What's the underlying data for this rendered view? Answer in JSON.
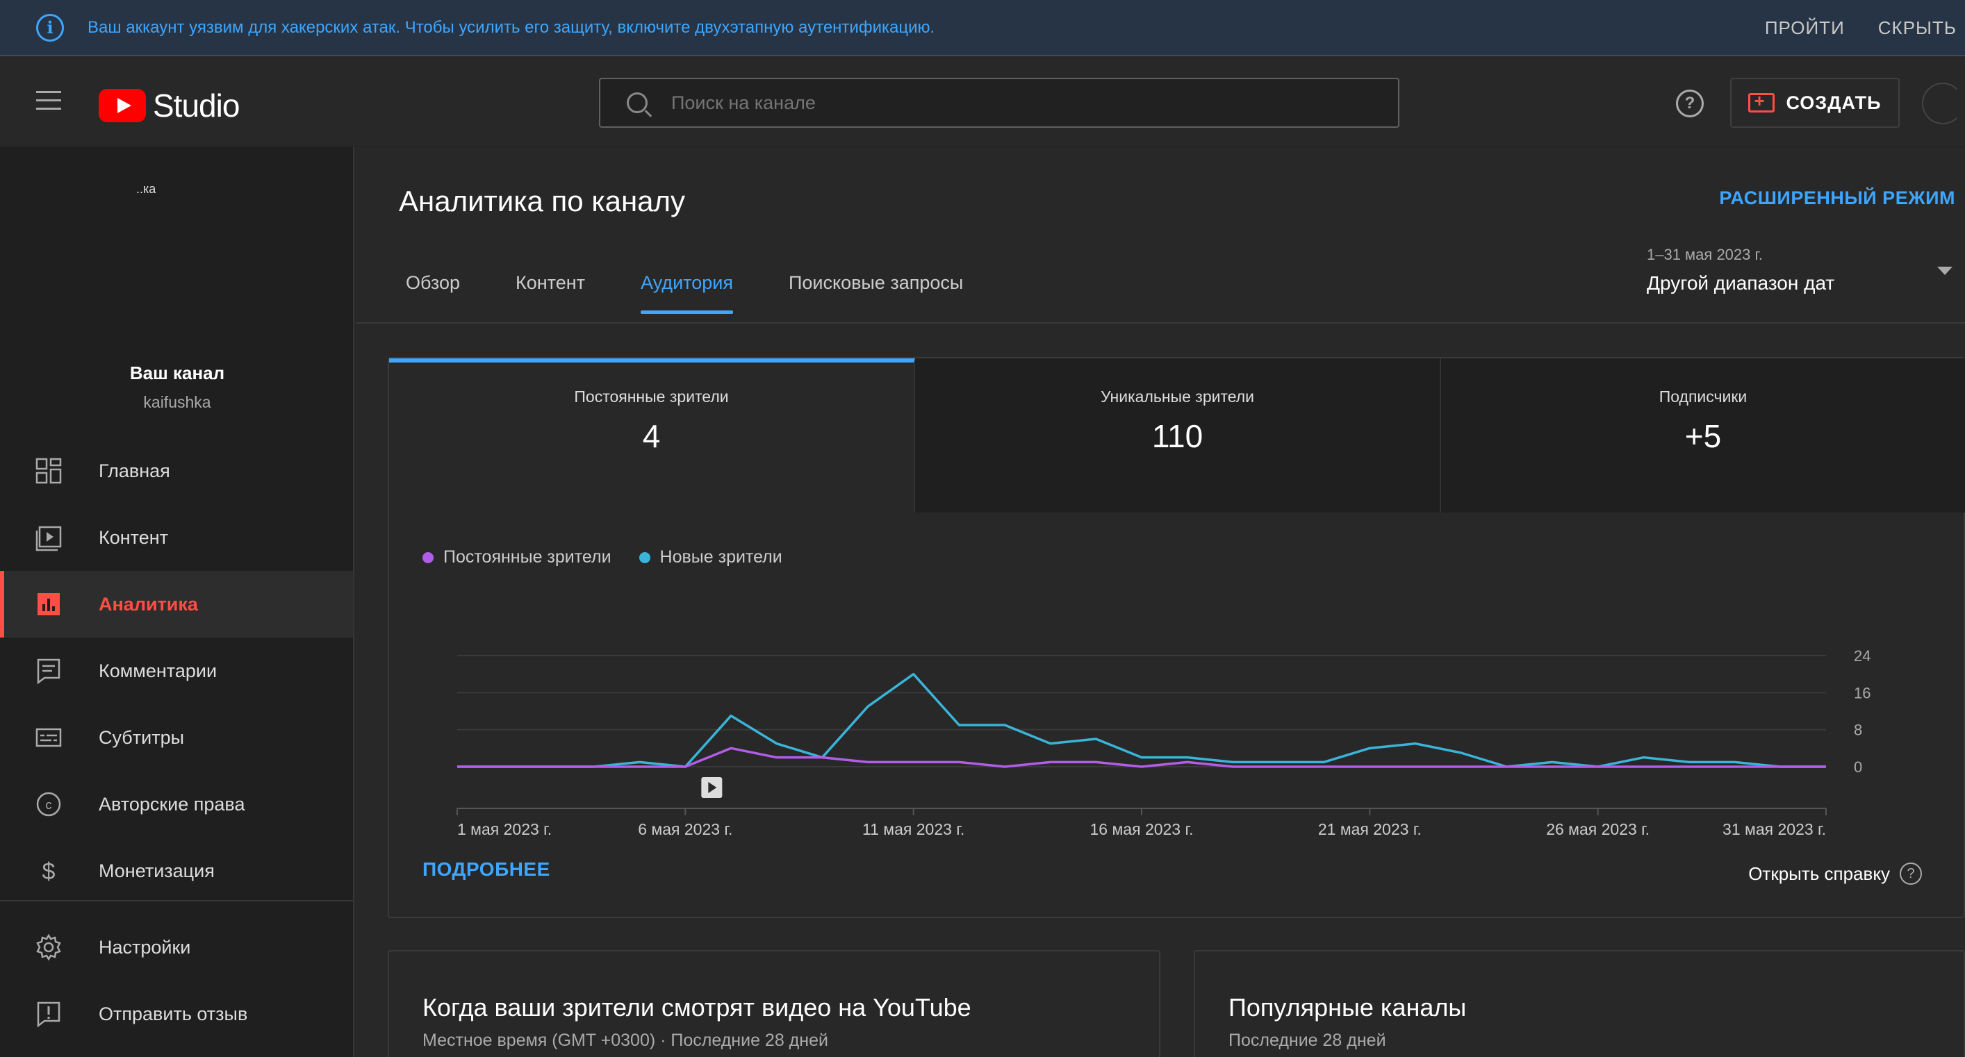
{
  "banner": {
    "message": "Ваш аккаунт уязвим для хакерских атак. Чтобы усилить его защиту, включите двухэтапную аутентификацию.",
    "action_go": "ПРОЙТИ",
    "action_hide": "СКРЫТЬ"
  },
  "header": {
    "logo_text": "Studio",
    "search_placeholder": "Поиск на канале",
    "create_label": "СОЗДАТЬ"
  },
  "sidebar": {
    "channel_thumb_text": "..ка",
    "channel_title": "Ваш канал",
    "channel_handle": "kaifushka",
    "items": [
      {
        "label": "Главная",
        "icon": "dashboard-icon"
      },
      {
        "label": "Контент",
        "icon": "content-icon"
      },
      {
        "label": "Аналитика",
        "icon": "analytics-icon",
        "active": true
      },
      {
        "label": "Комментарии",
        "icon": "comments-icon"
      },
      {
        "label": "Субтитры",
        "icon": "subtitles-icon"
      },
      {
        "label": "Авторские права",
        "icon": "copyright-icon"
      },
      {
        "label": "Монетизация",
        "icon": "monetization-icon"
      },
      {
        "label": "Настройки",
        "icon": "settings-icon"
      },
      {
        "label": "Отправить отзыв",
        "icon": "feedback-icon"
      }
    ]
  },
  "main": {
    "page_title": "Аналитика по каналу",
    "advanced_mode": "РАСШИРЕННЫЙ РЕЖИМ",
    "tabs": [
      {
        "label": "Обзор"
      },
      {
        "label": "Контент"
      },
      {
        "label": "Аудитория",
        "active": true
      },
      {
        "label": "Поисковые запросы"
      }
    ],
    "date_range": {
      "dates": "1–31 мая 2023 г.",
      "label": "Другой диапазон дат"
    },
    "metrics": [
      {
        "label": "Постоянные зрители",
        "value": "4"
      },
      {
        "label": "Уникальные зрители",
        "value": "110"
      },
      {
        "label": "Подписчики",
        "value": "+5"
      }
    ],
    "more_link": "ПОДРОБНЕЕ",
    "help_link": "Открыть справку",
    "bottom_cards": [
      {
        "title": "Когда ваши зрители смотрят видео на YouTube",
        "subtitle": "Местное время (GMT +0300) · Последние 28 дней"
      },
      {
        "title": "Популярные каналы",
        "subtitle": "Последние 28 дней"
      }
    ]
  },
  "colors": {
    "accent": "#3ea6ff",
    "active_nav": "#ff4e45",
    "returning": "#b15de8",
    "new": "#3ab4d8"
  },
  "chart_data": {
    "type": "line",
    "x": [
      "1 мая",
      "2 мая",
      "3 мая",
      "4 мая",
      "5 мая",
      "6 мая",
      "7 мая",
      "8 мая",
      "9 мая",
      "10 мая",
      "11 мая",
      "12 мая",
      "13 мая",
      "14 мая",
      "15 мая",
      "16 мая",
      "17 мая",
      "18 мая",
      "19 мая",
      "20 мая",
      "21 мая",
      "22 мая",
      "23 мая",
      "24 мая",
      "25 мая",
      "26 мая",
      "27 мая",
      "28 мая",
      "29 мая",
      "30 мая",
      "31 мая"
    ],
    "x_tick_labels": [
      "1 мая 2023 г.",
      "6 мая 2023 г.",
      "11 мая 2023 г.",
      "16 мая 2023 г.",
      "21 мая 2023 г.",
      "26 мая 2023 г.",
      "31 мая 2023 г."
    ],
    "x_tick_indices": [
      0,
      5,
      10,
      15,
      20,
      25,
      30
    ],
    "y_ticks": [
      "24",
      "16",
      "8",
      "0"
    ],
    "ylim": [
      0,
      24
    ],
    "series": [
      {
        "name": "Постоянные зрители",
        "color": "#b15de8",
        "values": [
          0,
          0,
          0,
          0,
          0,
          0,
          4,
          2,
          2,
          1,
          1,
          1,
          0,
          1,
          1,
          0,
          1,
          0,
          0,
          0,
          0,
          0,
          0,
          0,
          0,
          0,
          0,
          0,
          0,
          0,
          0
        ]
      },
      {
        "name": "Новые зрители",
        "color": "#3ab4d8",
        "values": [
          0,
          0,
          0,
          0,
          1,
          0,
          11,
          5,
          2,
          13,
          20,
          9,
          9,
          5,
          6,
          2,
          2,
          1,
          1,
          1,
          4,
          5,
          3,
          0,
          1,
          0,
          2,
          1,
          1,
          0,
          0
        ]
      }
    ],
    "legend": "top-left",
    "grid": true,
    "marker_day_index": 5
  }
}
